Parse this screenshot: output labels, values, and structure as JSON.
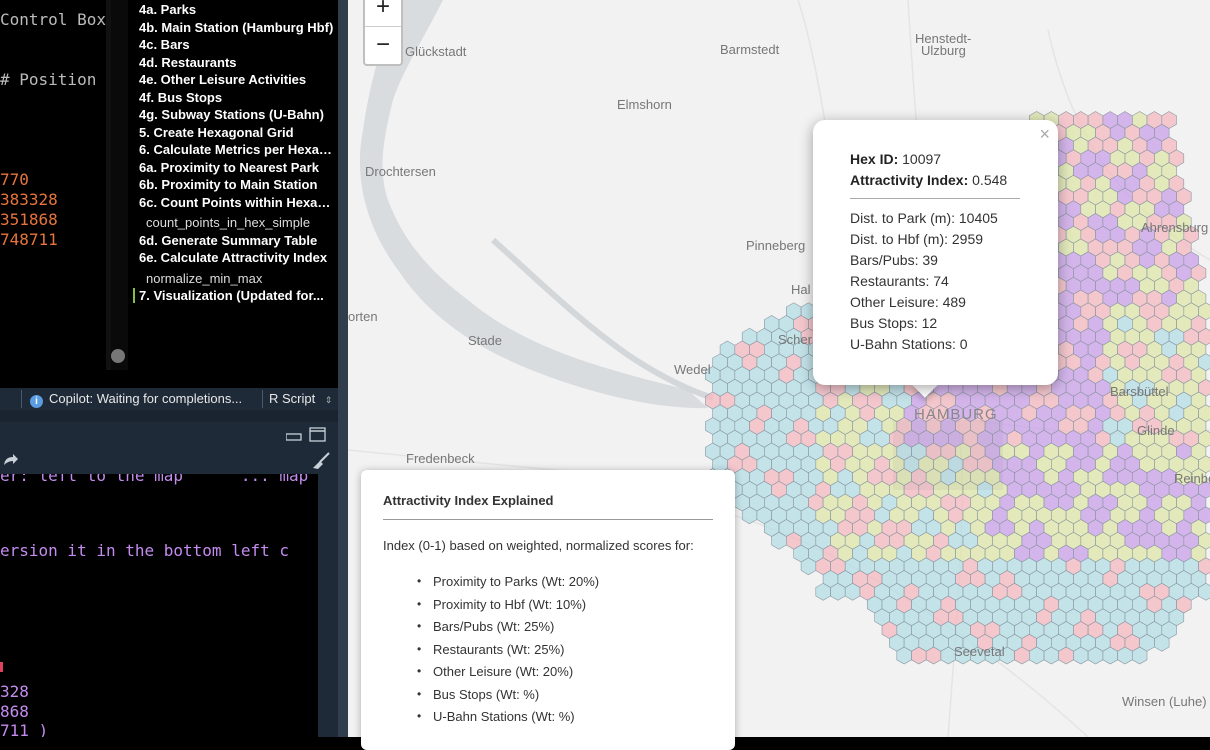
{
  "editor": {
    "lines": [
      {
        "text": "Control Box",
        "color": "#bbbbbb"
      },
      {
        "text": "# Position",
        "color": "#bbbbbb"
      },
      {
        "text": "770",
        "color": "#e8743b"
      },
      {
        "text": "383328",
        "color": "#e8743b"
      },
      {
        "text": "351868",
        "color": "#e8743b"
      },
      {
        "text": "748711",
        "color": "#e8743b"
      }
    ]
  },
  "outline": {
    "items": [
      {
        "label": "4a. Parks"
      },
      {
        "label": "4b. Main Station (Hamburg Hbf)"
      },
      {
        "label": "4c. Bars"
      },
      {
        "label": "4d. Restaurants"
      },
      {
        "label": "4e. Other Leisure Activities"
      },
      {
        "label": "4f. Bus Stops"
      },
      {
        "label": "4g. Subway Stations (U-Bahn)"
      },
      {
        "label": "5. Create Hexagonal Grid"
      },
      {
        "label": "6. Calculate Metrics per Hexagon"
      },
      {
        "label": "6a. Proximity to Nearest Park"
      },
      {
        "label": "6b. Proximity to Main Station"
      },
      {
        "label": "6c. Count Points within Hexagons"
      },
      {
        "label": "count_points_in_hex_simple"
      },
      {
        "label": "6d. Generate Summary Table"
      },
      {
        "label": "6e. Calculate Attractivity Index"
      },
      {
        "label": "normalize_min_max"
      },
      {
        "label": "7. Visualization (Updated for..."
      }
    ]
  },
  "statusbar": {
    "copilot": "Copilot: Waiting for completions...",
    "filetype": "R Script"
  },
  "console": {
    "lines": [
      "ersion it in the bottom left c",
      "328",
      "868",
      "711 )"
    ],
    "partial_top": "er: left to the map      ... map"
  },
  "map": {
    "zoom_in": "+",
    "zoom_out": "−",
    "places": [
      {
        "name": "Glückstadt"
      },
      {
        "name": "Barmstedt"
      },
      {
        "name": "Henstedt-"
      },
      {
        "name": "Ulzburg"
      },
      {
        "name": "Elmshorn"
      },
      {
        "name": "Drochtersen"
      },
      {
        "name": "Pinneberg"
      },
      {
        "name": "Ahrensburg"
      },
      {
        "name": "orten"
      },
      {
        "name": "Stade"
      },
      {
        "name": "Wedel"
      },
      {
        "name": "Hal"
      },
      {
        "name": "Scher"
      },
      {
        "name": "HAMBURG"
      },
      {
        "name": "Barsbüttel"
      },
      {
        "name": "Glinde"
      },
      {
        "name": "Fredenbeck"
      },
      {
        "name": "Reinbe"
      },
      {
        "name": "Seevetal"
      },
      {
        "name": "Winsen (Luhe)"
      }
    ],
    "hex_colors": {
      "high": "#c9a0e8",
      "mid_high": "#f4b8c0",
      "mid": "#dde5a8",
      "low": "#b3dde6"
    }
  },
  "popup": {
    "close": "×",
    "hex_id_label": "Hex ID:",
    "hex_id": "10097",
    "index_label": "Attractivity Index:",
    "index_value": "0.548",
    "lines": [
      "Dist. to Park (m): 10405",
      "Dist. to Hbf (m): 2959",
      "Bars/Pubs: 39",
      "Restaurants: 74",
      "Other Leisure: 489",
      "Bus Stops: 12",
      "U-Bahn Stations: 0"
    ]
  },
  "legend": {
    "title": "Attractivity Index Explained",
    "description": "Index (0-1) based on weighted, normalized scores for:",
    "items": [
      "Proximity to Parks (Wt: 20%)",
      "Proximity to Hbf (Wt: 10%)",
      "Bars/Pubs (Wt: 25%)",
      "Restaurants (Wt: 25%)",
      "Other Leisure (Wt: 20%)",
      "Bus Stops (Wt: %)",
      "U-Bahn Stations (Wt: %)"
    ]
  }
}
